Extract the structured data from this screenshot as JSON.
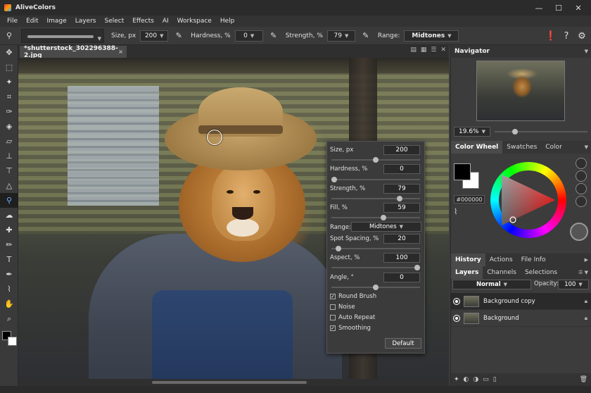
{
  "app": {
    "title": "AliveColors"
  },
  "window_controls": {
    "minimize": "—",
    "maximize": "☐",
    "close": "✕"
  },
  "menu": [
    "File",
    "Edit",
    "Image",
    "Layers",
    "Select",
    "Effects",
    "AI",
    "Workspace",
    "Help"
  ],
  "options_bar": {
    "size_label": "Size, px",
    "size_value": "200",
    "hardness_label": "Hardness, %",
    "hardness_value": "0",
    "strength_label": "Strength, %",
    "strength_value": "79",
    "range_label": "Range:",
    "range_value": "Midtones"
  },
  "document": {
    "tab_title": "*shutterstock_302296388-2.jpg",
    "close_glyph": "×"
  },
  "brush_popup": {
    "size_label": "Size, px",
    "size_value": "200",
    "size_level": 0.5,
    "hardness_label": "Hardness, %",
    "hardness_value": "0",
    "hardness_level": 0,
    "strength_label": "Strength, %",
    "strength_value": "79",
    "strength_level": 0.79,
    "fill_label": "Fill, %",
    "fill_value": "59",
    "fill_level": 0.59,
    "range_label": "Range:",
    "range_value": "Midtones",
    "spacing_label": "Spot Spacing, %",
    "spacing_value": "20",
    "spacing_level": 0.05,
    "aspect_label": "Aspect, %",
    "aspect_value": "100",
    "aspect_level": 1.0,
    "angle_label": "Angle, °",
    "angle_value": "0",
    "angle_level": 0.5,
    "round_brush_label": "Round Brush",
    "round_brush_checked": true,
    "noise_label": "Noise",
    "noise_checked": false,
    "auto_repeat_label": "Auto Repeat",
    "auto_repeat_checked": false,
    "smoothing_label": "Smoothing",
    "smoothing_checked": true,
    "default_button": "Default"
  },
  "navigator": {
    "title": "Navigator",
    "zoom_value": "19.6%",
    "zoom_level": 0.2
  },
  "color_panel": {
    "tabs": [
      "Color Wheel",
      "Swatches",
      "Color"
    ],
    "hex_value": "#000000",
    "foreground_color": "#000000",
    "background_color": "#ffffff"
  },
  "history_tabs": [
    "History",
    "Actions",
    "File Info"
  ],
  "layers_panel": {
    "tabs": [
      "Layers",
      "Channels",
      "Selections"
    ],
    "blend_mode": "Normal",
    "opacity_label": "Opacity:",
    "opacity_value": "100",
    "layers": [
      {
        "name": "Background copy",
        "selected": true
      },
      {
        "name": "Background",
        "selected": false
      }
    ]
  }
}
